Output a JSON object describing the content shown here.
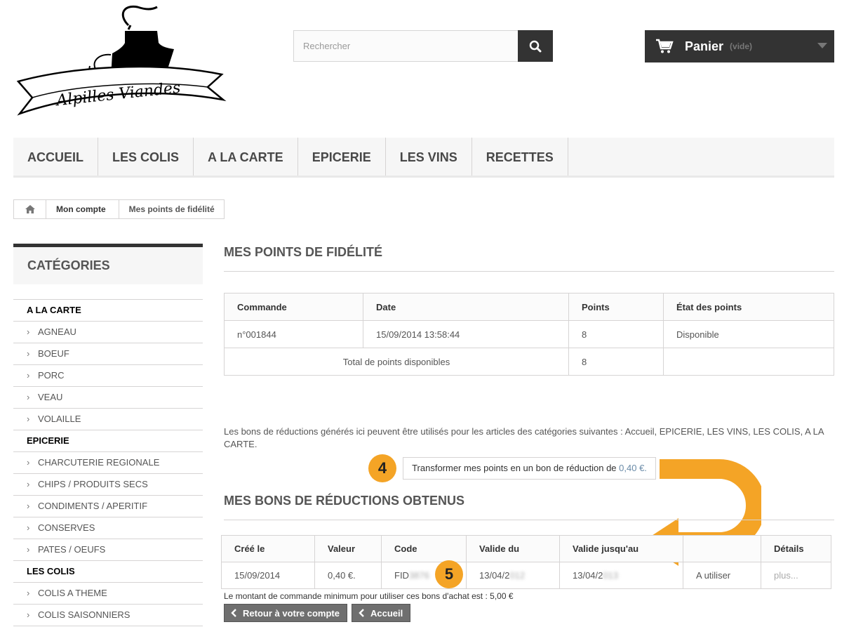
{
  "logo": {
    "text": "Alpilles Viandes"
  },
  "search": {
    "placeholder": "Rechercher"
  },
  "cart": {
    "label": "Panier",
    "status": "(vide)"
  },
  "menu": [
    "ACCUEIL",
    "LES COLIS",
    "A LA CARTE",
    "EPICERIE",
    "LES VINS",
    "RECETTES"
  ],
  "breadcrumb": {
    "account": "Mon compte",
    "current": "Mes points de fidélité"
  },
  "sidebar": {
    "title": "CATÉGORIES",
    "items": [
      {
        "label": "A LA CARTE",
        "level": "top"
      },
      {
        "label": "AGNEAU",
        "level": "sub"
      },
      {
        "label": "BOEUF",
        "level": "sub"
      },
      {
        "label": "PORC",
        "level": "sub"
      },
      {
        "label": "VEAU",
        "level": "sub"
      },
      {
        "label": "VOLAILLE",
        "level": "sub"
      },
      {
        "label": "EPICERIE",
        "level": "top"
      },
      {
        "label": "CHARCUTERIE REGIONALE",
        "level": "sub"
      },
      {
        "label": "CHIPS / PRODUITS SECS",
        "level": "sub"
      },
      {
        "label": "CONDIMENTS / APERITIF",
        "level": "sub"
      },
      {
        "label": "CONSERVES",
        "level": "sub"
      },
      {
        "label": "PATES / OEUFS",
        "level": "sub"
      },
      {
        "label": "LES COLIS",
        "level": "top"
      },
      {
        "label": "COLIS A THEME",
        "level": "sub"
      },
      {
        "label": "COLIS SAISONNIERS",
        "level": "sub"
      }
    ]
  },
  "points": {
    "title": "MES POINTS DE FIDÉLITÉ",
    "headers": [
      "Commande",
      "Date",
      "Points",
      "État des points"
    ],
    "row": {
      "order": "n°001844",
      "date": "15/09/2014 13:58:44",
      "points": "8",
      "state": "Disponible"
    },
    "total_label": "Total de points disponibles",
    "total_value": "8"
  },
  "info_text": "Les bons de réductions générés ici peuvent être utilisés pour les articles des catégories suivantes : Accueil, EPICERIE, LES VINS, LES COLIS, A LA CARTE.",
  "transform": {
    "label": "Transformer mes points en un bon de réduction de ",
    "value": "0,40 €."
  },
  "badges": {
    "first": "4",
    "second": "5"
  },
  "vouchers": {
    "title": "MES BONS DE RÉDUCTIONS OBTENUS",
    "headers": [
      "Créé le",
      "Valeur",
      "Code",
      "Valide du",
      "Valide jusqu'au",
      "",
      "Détails"
    ],
    "row": {
      "created": "15/09/2014",
      "value": "0,40 €.",
      "code_prefix": "FID",
      "code_hidden": "3876",
      "valid_from": "13/04/2",
      "valid_from_hidden": "012",
      "valid_to": "13/04/2",
      "valid_to_hidden": "013",
      "status": "A utiliser",
      "details": "plus..."
    }
  },
  "min_amount": "Le montant de commande minimum pour utiliser ces bons d'achat est : 5,00 €",
  "buttons": {
    "back": "Retour à votre compte",
    "home": "Accueil"
  },
  "colors": {
    "accent_orange": "#f4a426",
    "dark": "#333333"
  }
}
